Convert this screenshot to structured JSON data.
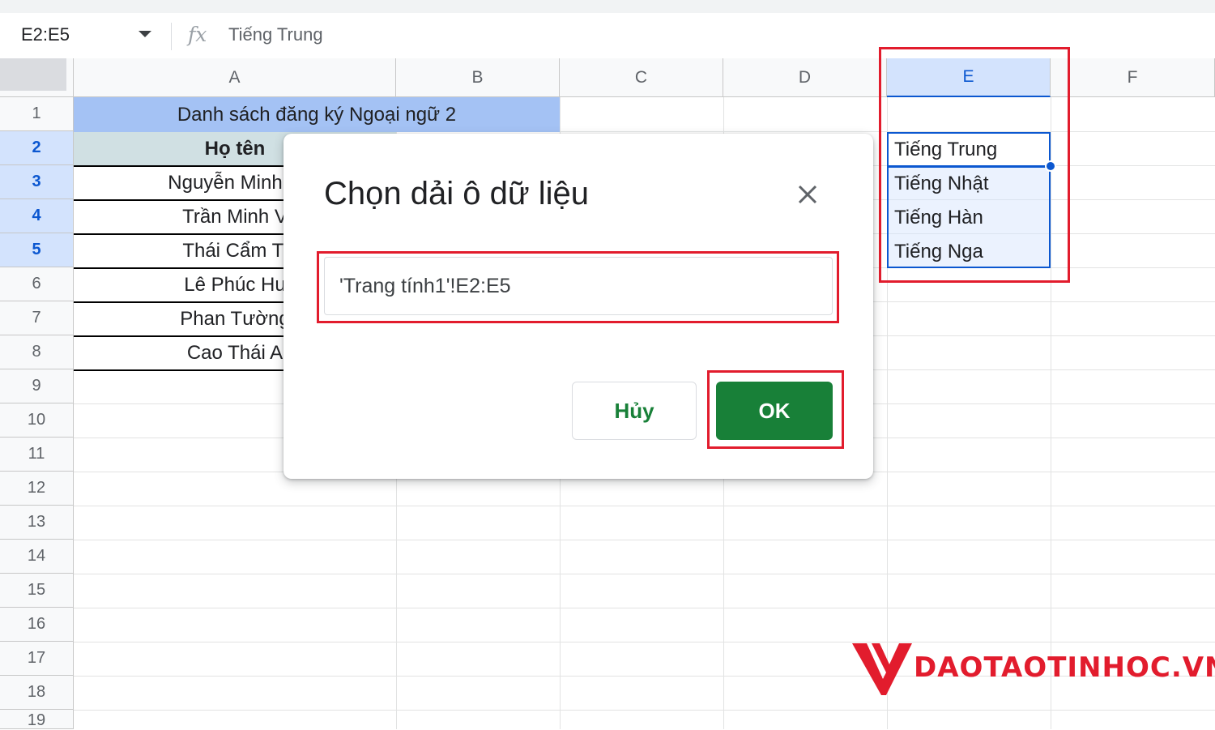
{
  "formula_bar": {
    "name_box": "E2:E5",
    "fx_symbol": "fx",
    "content": "Tiếng Trung"
  },
  "grid": {
    "columns": [
      "A",
      "B",
      "C",
      "D",
      "E",
      "F"
    ],
    "selected_column": "E",
    "rows": [
      "1",
      "2",
      "3",
      "4",
      "5",
      "6",
      "7",
      "8",
      "9",
      "10",
      "11",
      "12",
      "13",
      "14",
      "15",
      "16",
      "17",
      "18",
      "19"
    ],
    "selected_rows": [
      "2",
      "3",
      "4",
      "5"
    ],
    "title_cell": "Danh sách đăng ký Ngoại ngữ 2",
    "header_cell": "Họ tên",
    "names": [
      "Nguyễn Minh H",
      "Trần Minh V",
      "Thái Cẩm Ti",
      "Lê Phúc Hu",
      "Phan Tường",
      "Cao Thái A"
    ],
    "languages": [
      "Tiếng Trung",
      "Tiếng Nhật",
      "Tiếng Hàn",
      "Tiếng Nga"
    ]
  },
  "dialog": {
    "title": "Chọn dải ô dữ liệu",
    "close_icon": "close-icon",
    "range_value": "'Trang tính1'!E2:E5",
    "cancel_label": "Hủy",
    "ok_label": "OK"
  },
  "watermark": {
    "text": "DAOTAOTINHOC.VN"
  },
  "colors": {
    "highlight_red": "#e21c2d",
    "ok_green": "#188038",
    "selection_blue": "#0b57d0",
    "title_fill": "#a4c2f4",
    "header_fill": "#d0e0e3"
  }
}
